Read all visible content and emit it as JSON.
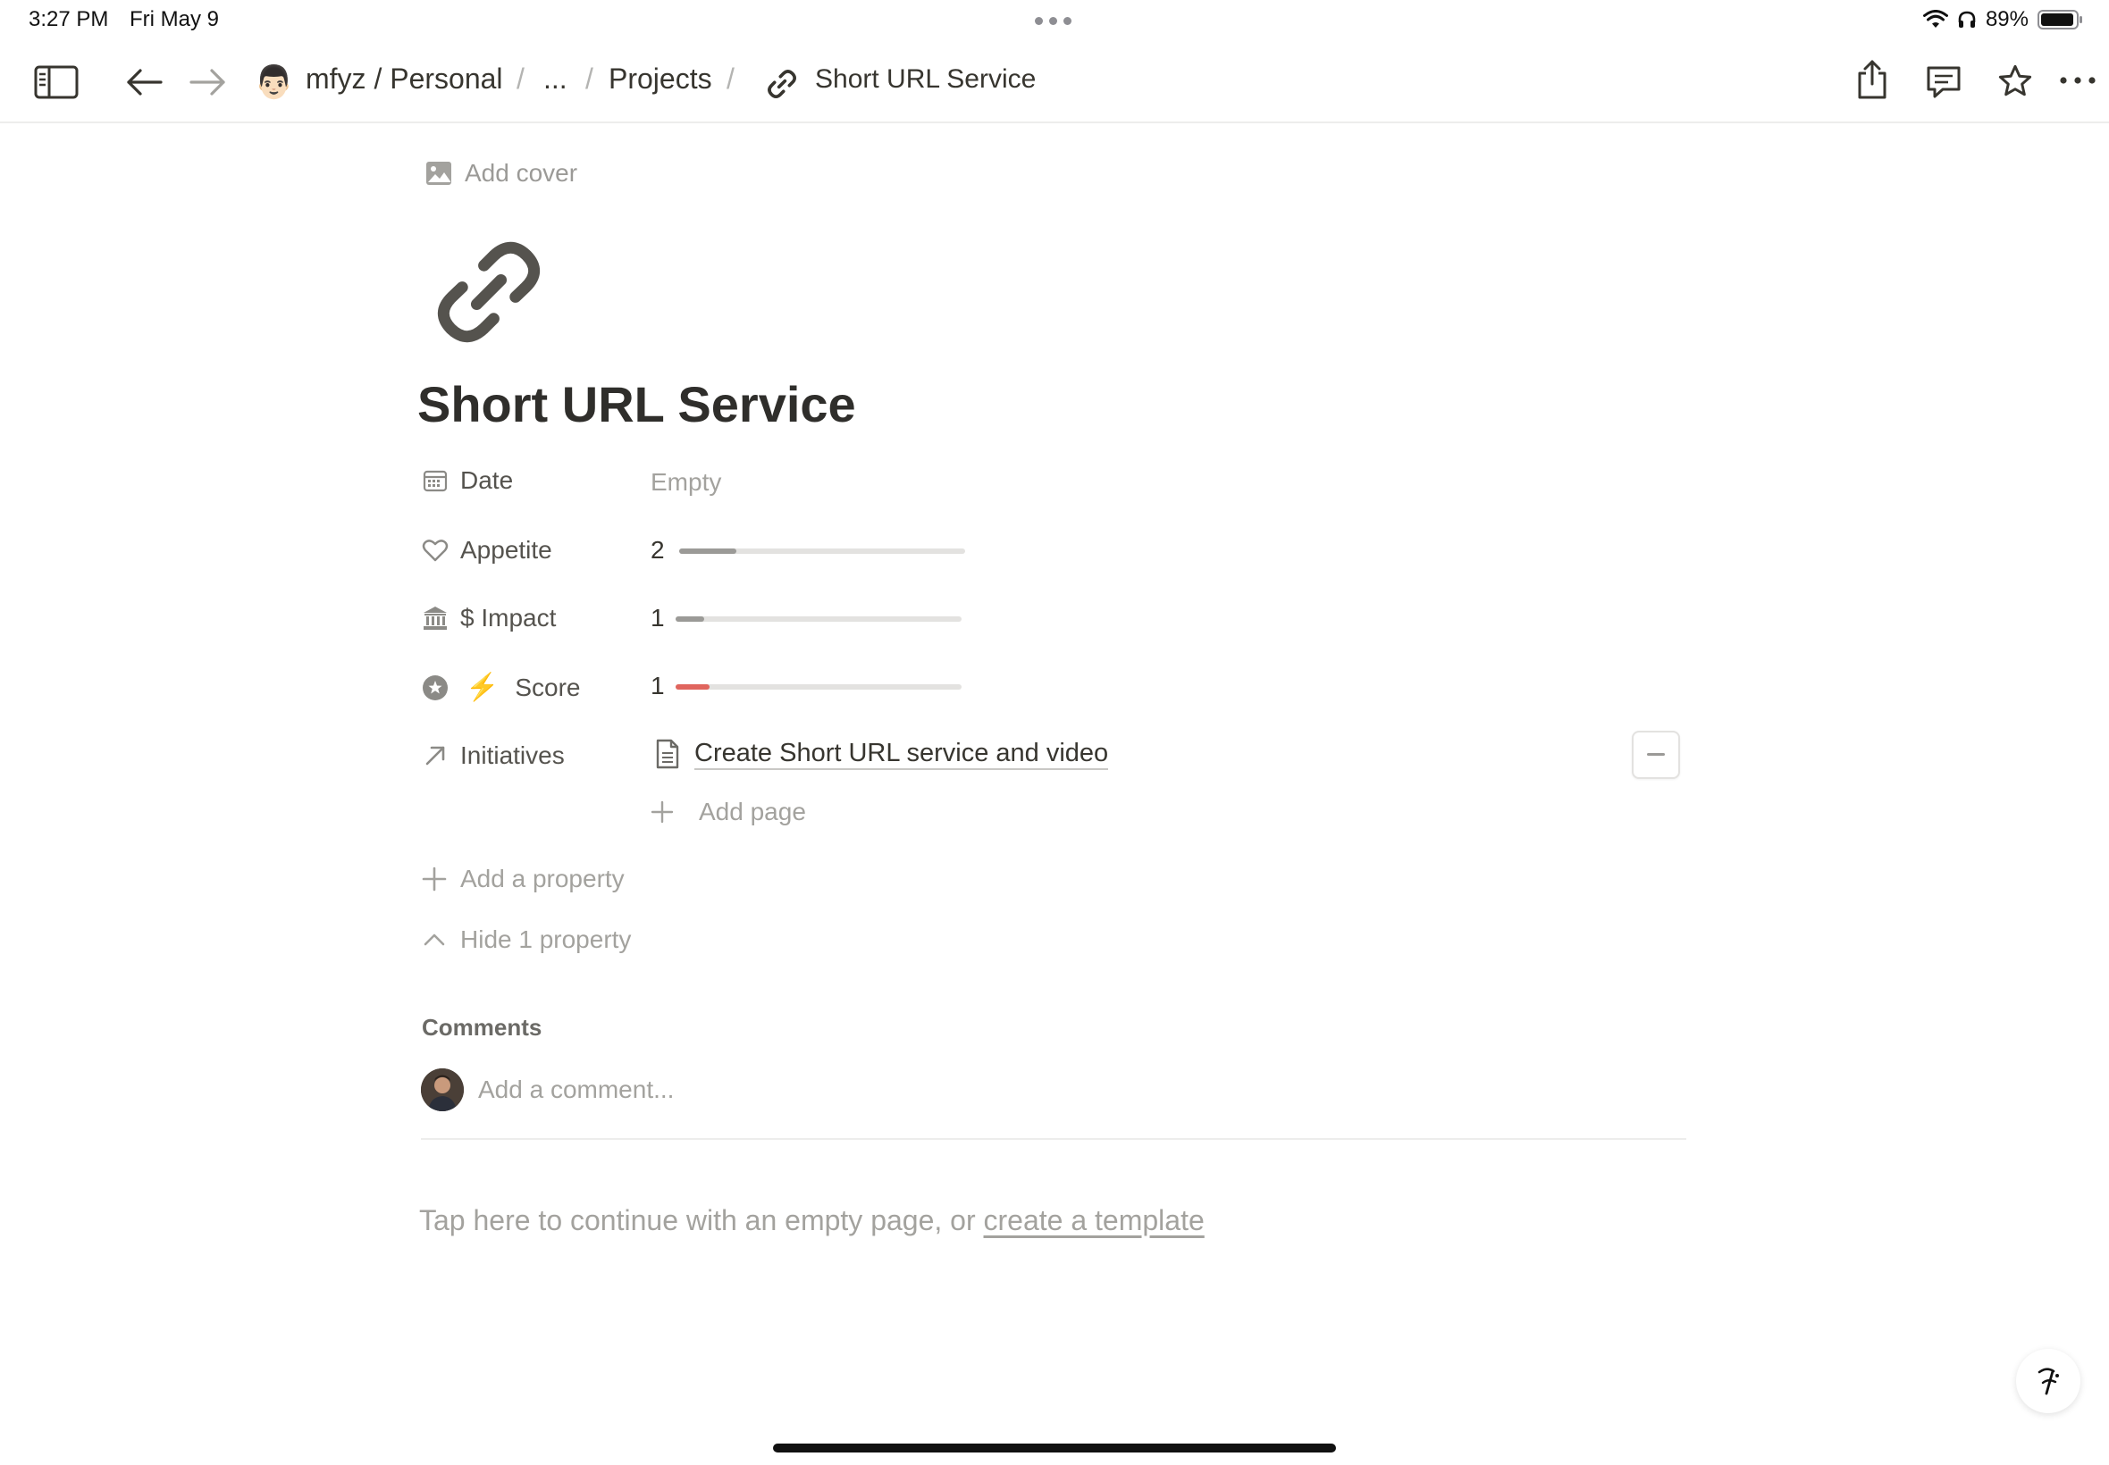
{
  "status": {
    "time": "3:27 PM",
    "date": "Fri May 9",
    "battery": "89%"
  },
  "toolbar": {
    "workspace": "mfyz / Personal",
    "ellipsis": "...",
    "projects": "Projects",
    "separator": "/",
    "current_page": "Short URL Service",
    "workspace_emoji": "👨🏻"
  },
  "page": {
    "add_cover": "Add cover",
    "title": "Short URL Service",
    "icon": "link-icon"
  },
  "properties": {
    "date": {
      "label": "Date",
      "value": "Empty"
    },
    "appetite": {
      "label": "Appetite",
      "value": "2",
      "progress": 0.2
    },
    "impact": {
      "label": "$ Impact",
      "value": "1",
      "progress": 0.1
    },
    "score": {
      "label": "Score",
      "emoji": "⚡",
      "value": "1",
      "progress": 0.12
    },
    "initiatives": {
      "label": "Initiatives",
      "page": "Create Short URL service and video",
      "add_page": "Add page"
    },
    "add_property": "Add a property",
    "hide_property": "Hide 1 property"
  },
  "comments": {
    "heading": "Comments",
    "placeholder": "Add a comment..."
  },
  "empty_hint": {
    "text": "Tap here to continue with an empty page, or ",
    "link": "create a template"
  },
  "colors": {
    "score_bar": "#e0655e",
    "progress_bar": "#9b9a97",
    "track": "#e3e2e0"
  }
}
